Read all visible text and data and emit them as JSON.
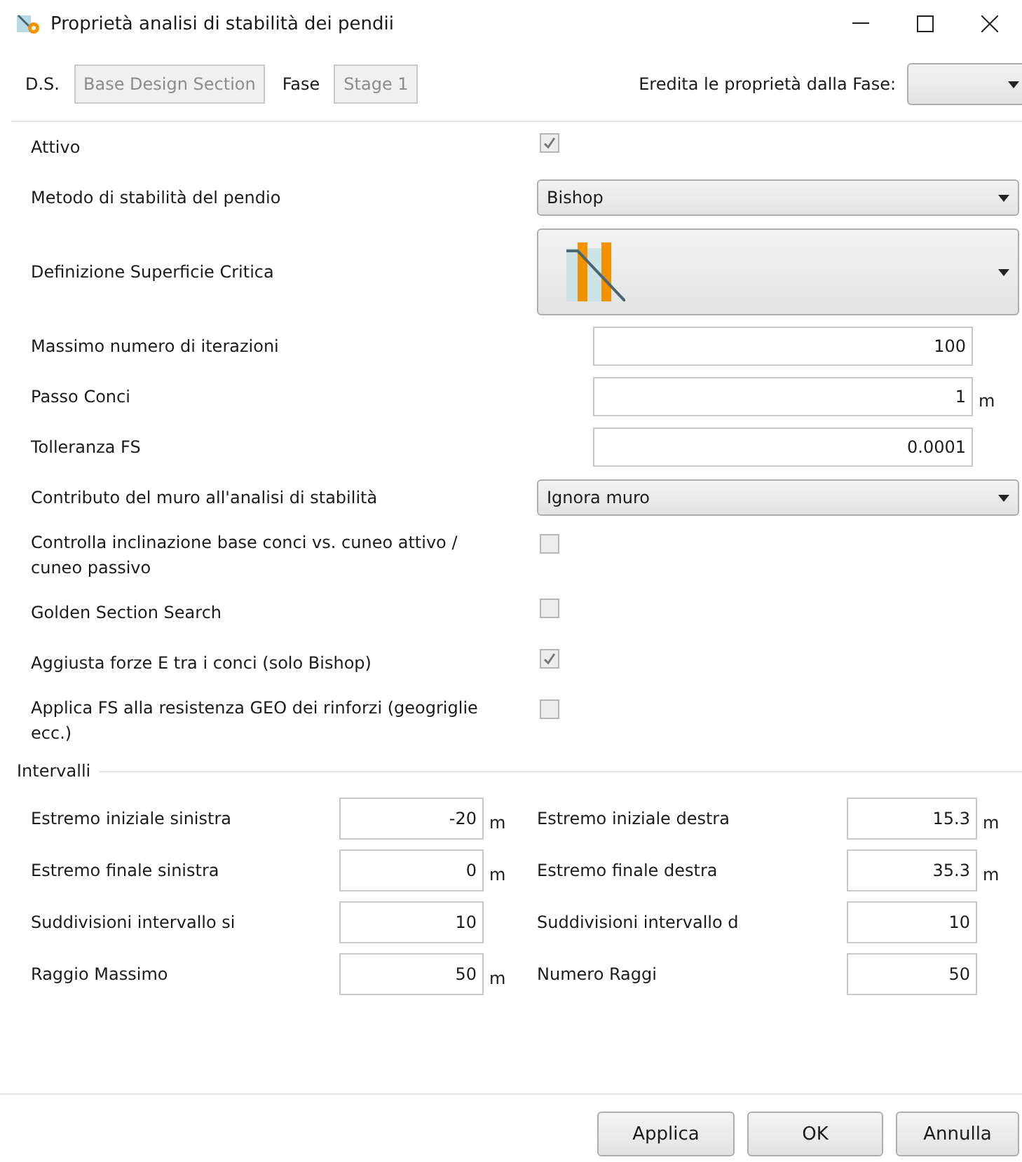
{
  "window": {
    "title": "Proprietà analisi di stabilità dei pendii"
  },
  "header": {
    "ds_label": "D.S.",
    "ds_value": "Base Design Section",
    "phase_label": "Fase",
    "phase_value": "Stage 1",
    "inherit_label": "Eredita le proprietà dalla Fase:"
  },
  "properties": [
    {
      "kind": "checkbox",
      "label": "Attivo",
      "checked": true
    },
    {
      "kind": "dropdown",
      "label": "Metodo di stabilità del pendio",
      "value": "Bishop"
    },
    {
      "kind": "icon-dropdown",
      "label": "Definizione Superficie Critica"
    },
    {
      "kind": "number",
      "label": "Massimo numero di iterazioni",
      "value": "100"
    },
    {
      "kind": "number",
      "label": "Passo Conci",
      "value": "1",
      "unit": "m"
    },
    {
      "kind": "number",
      "label": "Tolleranza FS",
      "value": "0.0001"
    },
    {
      "kind": "dropdown",
      "label": "Contributo del muro all'analisi di stabilità",
      "value": "Ignora muro"
    },
    {
      "kind": "checkbox",
      "label": "Controlla inclinazione base conci vs. cuneo attivo / cuneo passivo",
      "checked": false
    },
    {
      "kind": "checkbox",
      "label": "Golden Section Search",
      "checked": false
    },
    {
      "kind": "checkbox",
      "label": "Aggiusta forze E tra i conci (solo Bishop)",
      "checked": true
    },
    {
      "kind": "checkbox",
      "label": "Applica FS alla resistenza GEO dei rinforzi (geogriglie ecc.)",
      "checked": false
    }
  ],
  "intervals": {
    "title": "Intervalli",
    "fields": [
      {
        "label": "Estremo iniziale sinistra",
        "value": "-20",
        "unit": "m"
      },
      {
        "label": "Estremo iniziale destra",
        "value": "15.3",
        "unit": "m"
      },
      {
        "label": "Estremo finale sinistra",
        "value": "0",
        "unit": "m"
      },
      {
        "label": "Estremo finale destra",
        "value": "35.3",
        "unit": "m"
      },
      {
        "label": "Suddivisioni intervallo si",
        "value": "10"
      },
      {
        "label": "Suddivisioni intervallo d",
        "value": "10"
      },
      {
        "label": "Raggio Massimo",
        "value": "50",
        "unit": "m"
      },
      {
        "label": "Numero Raggi",
        "value": "50"
      }
    ]
  },
  "buttons": [
    "Applica",
    "OK",
    "Annulla"
  ]
}
